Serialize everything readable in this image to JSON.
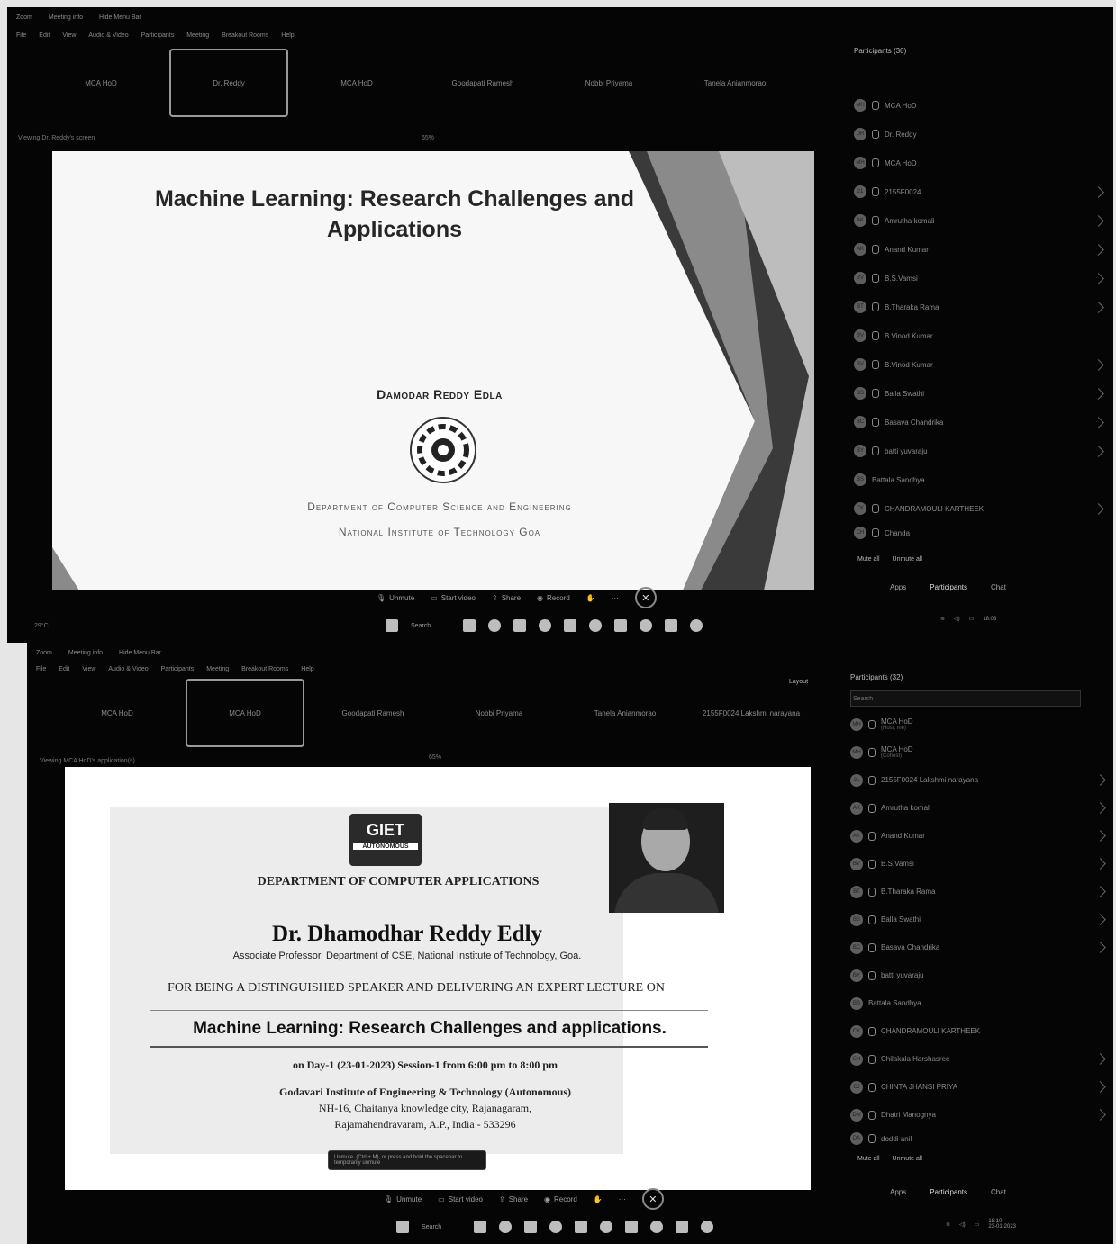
{
  "top_window": {
    "titlebar": [
      "Zoom",
      "Meeting info",
      "Hide Menu Bar"
    ],
    "menu": [
      "File",
      "Edit",
      "View",
      "Audio & Video",
      "Participants",
      "Meeting",
      "Breakout Rooms",
      "Help"
    ],
    "video_tiles": [
      {
        "name": "MCA HoD",
        "sub": "",
        "selected": false
      },
      {
        "name": "Dr. Reddy",
        "sub": "",
        "selected": true
      },
      {
        "name": "MCA HoD",
        "sub": "",
        "selected": false
      },
      {
        "name": "Goodapati Ramesh",
        "sub": "",
        "selected": false
      },
      {
        "name": "Nobbi Priyama",
        "sub": "",
        "selected": false
      },
      {
        "name": "Tanela Anianmorao",
        "sub": "",
        "selected": false
      }
    ],
    "viewing": "Viewing Dr. Reddy's screen",
    "zoom": "65%",
    "slide": {
      "title_line1": "Machine Learning: Research Challenges and",
      "title_line2": "Applications",
      "author": "Damodar Reddy Edla",
      "department": "Department of Computer Science and Engineering",
      "institute": "National Institute of Technology Goa"
    },
    "participants": {
      "header": "Participants (30)",
      "items": [
        {
          "initials": "MH",
          "name": "MCA HoD",
          "sub": ""
        },
        {
          "initials": "DR",
          "name": "Dr. Reddy",
          "sub": ""
        },
        {
          "initials": "MH",
          "name": "MCA HoD",
          "sub": ""
        },
        {
          "initials": "21",
          "name": "2155F0024",
          "sub": ""
        },
        {
          "initials": "AK",
          "name": "Amrutha komali",
          "sub": ""
        },
        {
          "initials": "AK",
          "name": "Anand Kumar",
          "sub": ""
        },
        {
          "initials": "BV",
          "name": "B.S.Vamsi",
          "sub": ""
        },
        {
          "initials": "BT",
          "name": "B.Tharaka Rama",
          "sub": ""
        },
        {
          "initials": "BV",
          "name": "B.Vinod Kumar",
          "sub": ""
        },
        {
          "initials": "BV",
          "name": "B.Vinod Kumar",
          "sub": ""
        },
        {
          "initials": "BS",
          "name": "Balla Swathi",
          "sub": ""
        },
        {
          "initials": "BC",
          "name": "Basava Chandrika",
          "sub": ""
        },
        {
          "initials": "BY",
          "name": "batti yuvaraju",
          "sub": ""
        },
        {
          "initials": "BS",
          "name": "Battala Sandhya",
          "sub": ""
        },
        {
          "initials": "CK",
          "name": "CHANDRAMOULI KARTHEEK",
          "sub": ""
        },
        {
          "initials": "CH",
          "name": "Chanda",
          "sub": ""
        }
      ],
      "mute_all": "Mute all",
      "unmute_all": "Unmute all"
    },
    "toolbar": {
      "unmute": "Unmute",
      "start_video": "Start video",
      "share": "Share",
      "record": "Record"
    },
    "right_tabs": {
      "apps": "Apps",
      "participants": "Participants",
      "chat": "Chat"
    },
    "taskbar": {
      "search": "Search",
      "weather": "29°C",
      "clock": "18:03"
    }
  },
  "bottom_window": {
    "titlebar": [
      "Zoom",
      "Meeting info",
      "Hide Menu Bar"
    ],
    "menu": [
      "File",
      "Edit",
      "View",
      "Audio & Video",
      "Participants",
      "Meeting",
      "Breakout Rooms",
      "Help"
    ],
    "layout_label": "Layout",
    "video_tiles": [
      {
        "name": "MCA HoD",
        "sub": "",
        "selected": false
      },
      {
        "name": "MCA HoD",
        "sub": "",
        "selected": true
      },
      {
        "name": "Goodapati Ramesh",
        "sub": "",
        "selected": false
      },
      {
        "name": "Nobbi Priyama",
        "sub": "",
        "selected": false
      },
      {
        "name": "Tanela Anianmorao",
        "sub": "",
        "selected": false
      },
      {
        "name": "2155F0024 Lakshmi narayana",
        "sub": "",
        "selected": false
      }
    ],
    "viewing": "Viewing MCA HoD's application(s)",
    "zoom": "65%",
    "certificate": {
      "logo_text": "GIET",
      "logo_sub": "AUTONOMOUS",
      "department": "DEPARTMENT OF COMPUTER APPLICATIONS",
      "name": "Dr. Dhamodhar Reddy Edly",
      "designation": "Associate Professor, Department of CSE, National Institute of Technology, Goa.",
      "for_line": "FOR BEING A DISTINGUISHED SPEAKER AND DELIVERING AN EXPERT LECTURE ON",
      "topic": "Machine Learning: Research Challenges and applications.",
      "session": "on Day-1 (23-01-2023) Session-1 from 6:00 pm to 8:00 pm",
      "institute": "Godavari Institute of Engineering & Technology (Autonomous)",
      "address1": "NH-16, Chaitanya knowledge city, Rajanagaram,",
      "address2": "Rajamahendravaram, A.P., India - 533296"
    },
    "participants": {
      "header": "Participants (32)",
      "search_placeholder": "Search",
      "items": [
        {
          "initials": "MH",
          "name": "MCA HoD",
          "sub": "(Host, me)"
        },
        {
          "initials": "MH",
          "name": "MCA HoD",
          "sub": "(Cohost)"
        },
        {
          "initials": "2L",
          "name": "2155F0024 Lakshmi narayana",
          "sub": ""
        },
        {
          "initials": "AK",
          "name": "Amrutha komali",
          "sub": ""
        },
        {
          "initials": "AK",
          "name": "Anand Kumar",
          "sub": ""
        },
        {
          "initials": "BV",
          "name": "B.S.Vamsi",
          "sub": ""
        },
        {
          "initials": "BT",
          "name": "B.Tharaka Rama",
          "sub": ""
        },
        {
          "initials": "BS",
          "name": "Balla Swathi",
          "sub": ""
        },
        {
          "initials": "BC",
          "name": "Basava Chandrika",
          "sub": ""
        },
        {
          "initials": "BY",
          "name": "batti yuvaraju",
          "sub": ""
        },
        {
          "initials": "BS",
          "name": "Battala Sandhya",
          "sub": ""
        },
        {
          "initials": "CK",
          "name": "CHANDRAMOULI KARTHEEK",
          "sub": ""
        },
        {
          "initials": "CH",
          "name": "Chilakala Harshasree",
          "sub": ""
        },
        {
          "initials": "CJ",
          "name": "CHINTA JHANSI PRIYA",
          "sub": ""
        },
        {
          "initials": "DM",
          "name": "Dhatri Manognya",
          "sub": ""
        },
        {
          "initials": "DA",
          "name": "doddi anil",
          "sub": ""
        }
      ],
      "mute_all": "Mute all",
      "unmute_all": "Unmute all"
    },
    "tooltip": "Unmute. (Ctrl + M), or press and hold the spacebar to temporarily unmute",
    "toolbar": {
      "unmute": "Unmute",
      "start_video": "Start video",
      "share": "Share",
      "record": "Record"
    },
    "right_tabs": {
      "apps": "Apps",
      "participants": "Participants",
      "chat": "Chat"
    },
    "taskbar": {
      "search": "Search",
      "clock": "18:10",
      "date": "23-01-2023"
    }
  }
}
